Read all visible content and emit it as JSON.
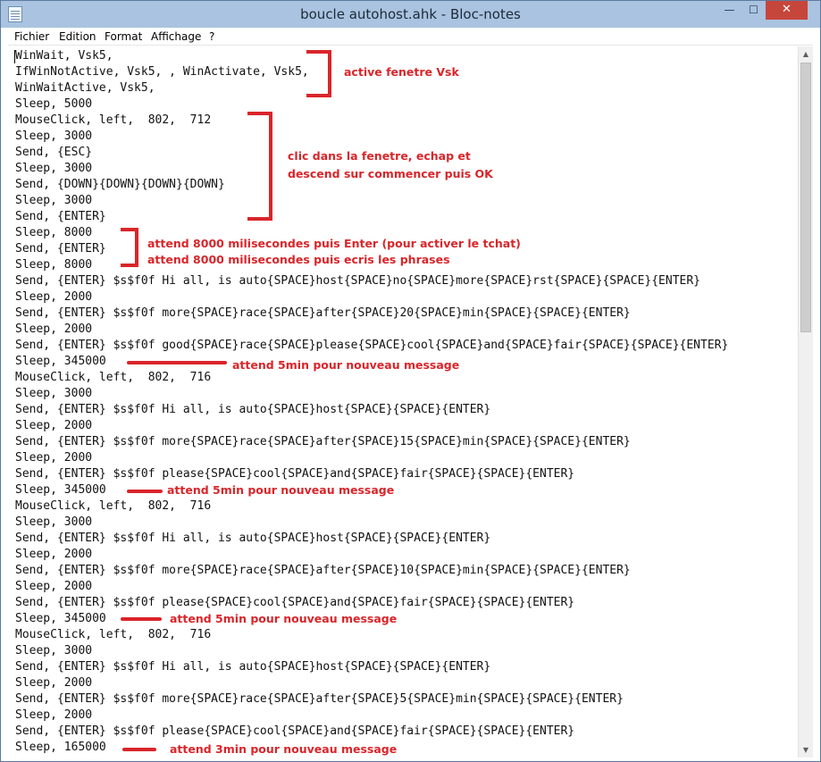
{
  "window": {
    "title": "boucle autohost.ahk - Bloc-notes",
    "minimize_glyph": "—",
    "maximize_glyph": "☐",
    "close_glyph": "✕"
  },
  "menu": {
    "items": [
      "Fichier",
      "Edition",
      "Format",
      "Affichage",
      "?"
    ]
  },
  "code_lines": [
    "WinWait, Vsk5,",
    "IfWinNotActive, Vsk5, , WinActivate, Vsk5,",
    "WinWaitActive, Vsk5,",
    "Sleep, 5000",
    "MouseClick, left,  802,  712",
    "Sleep, 3000",
    "Send, {ESC}",
    "Sleep, 3000",
    "Send, {DOWN}{DOWN}{DOWN}{DOWN}",
    "Sleep, 3000",
    "Send, {ENTER}",
    "Sleep, 8000",
    "Send, {ENTER}",
    "Sleep, 8000",
    "Send, {ENTER} $s$f0f Hi all, is auto{SPACE}host{SPACE}no{SPACE}more{SPACE}rst{SPACE}{SPACE}{ENTER}",
    "Sleep, 2000",
    "Send, {ENTER} $s$f0f more{SPACE}race{SPACE}after{SPACE}20{SPACE}min{SPACE}{SPACE}{ENTER}",
    "Sleep, 2000",
    "Send, {ENTER} $s$f0f good{SPACE}race{SPACE}please{SPACE}cool{SPACE}and{SPACE}fair{SPACE}{SPACE}{ENTER}",
    "Sleep, 345000",
    "MouseClick, left,  802,  716",
    "Sleep, 3000",
    "Send, {ENTER} $s$f0f Hi all, is auto{SPACE}host{SPACE}{SPACE}{ENTER}",
    "Sleep, 2000",
    "Send, {ENTER} $s$f0f more{SPACE}race{SPACE}after{SPACE}15{SPACE}min{SPACE}{SPACE}{ENTER}",
    "Sleep, 2000",
    "Send, {ENTER} $s$f0f please{SPACE}cool{SPACE}and{SPACE}fair{SPACE}{SPACE}{ENTER}",
    "Sleep, 345000",
    "MouseClick, left,  802,  716",
    "Sleep, 3000",
    "Send, {ENTER} $s$f0f Hi all, is auto{SPACE}host{SPACE}{SPACE}{ENTER}",
    "Sleep, 2000",
    "Send, {ENTER} $s$f0f more{SPACE}race{SPACE}after{SPACE}10{SPACE}min{SPACE}{SPACE}{ENTER}",
    "Sleep, 2000",
    "Send, {ENTER} $s$f0f please{SPACE}cool{SPACE}and{SPACE}fair{SPACE}{SPACE}{ENTER}",
    "Sleep, 345000",
    "MouseClick, left,  802,  716",
    "Sleep, 3000",
    "Send, {ENTER} $s$f0f Hi all, is auto{SPACE}host{SPACE}{SPACE}{ENTER}",
    "Sleep, 2000",
    "Send, {ENTER} $s$f0f more{SPACE}race{SPACE}after{SPACE}5{SPACE}min{SPACE}{SPACE}{ENTER}",
    "Sleep, 2000",
    "Send, {ENTER} $s$f0f please{SPACE}cool{SPACE}and{SPACE}fair{SPACE}{SPACE}{ENTER}",
    "Sleep, 165000"
  ],
  "annotations": {
    "active_window": "active fenetre Vsk",
    "click_line1": "clic dans la fenetre, echap et",
    "click_line2": "descend sur commencer puis OK",
    "wait_enter": "attend 8000 milisecondes puis Enter (pour activer le tchat)",
    "wait_write": "attend 8000 milisecondes puis ecris les phrases",
    "wait_5min_1": "attend 5min pour nouveau message",
    "wait_5min_2": "attend 5min pour nouveau message",
    "wait_5min_3": "attend 5min pour nouveau message",
    "wait_3min": "attend 3min pour nouveau message"
  },
  "colors": {
    "annotation_red": "#d9252a",
    "titlebar": "#a9c3e0",
    "close_button": "#c7463b"
  }
}
